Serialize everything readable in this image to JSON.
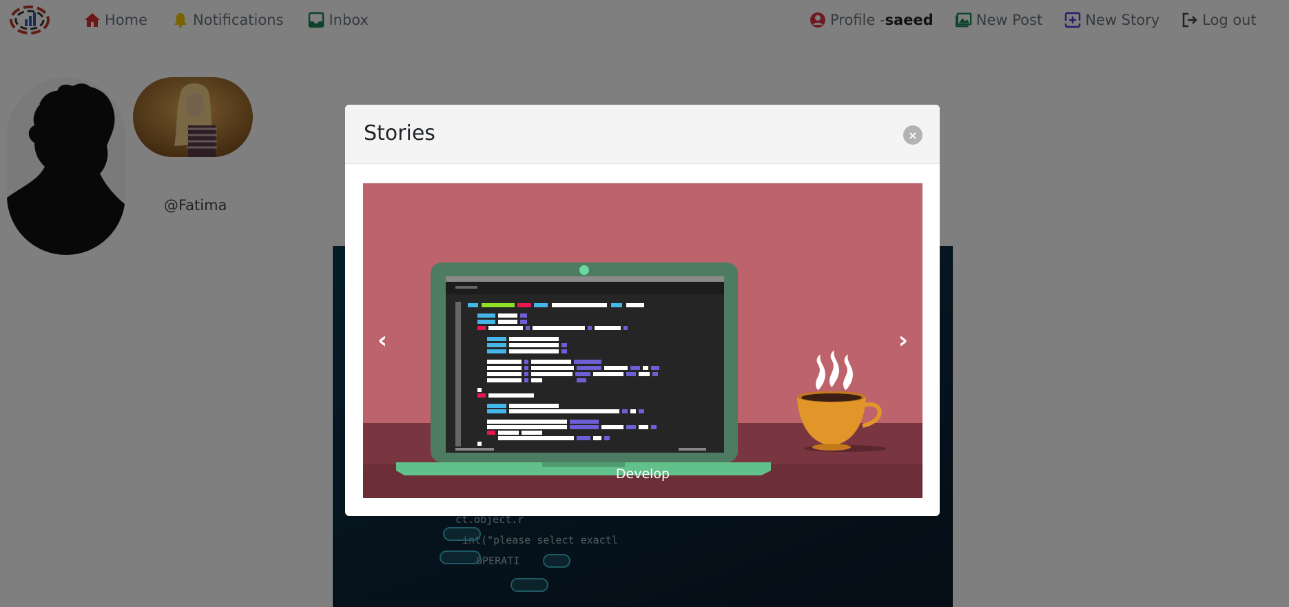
{
  "nav": {
    "home": "Home",
    "notifications": "Notifications",
    "inbox": "Inbox",
    "profile_prefix": "Profile -",
    "profile_user": "saeed",
    "new_post": "New Post",
    "new_story": "New Story",
    "logout": "Log out"
  },
  "stories_row": {
    "username": "@Fatima"
  },
  "post": {
    "code_lines": [
      "ct.object.r",
      "int(\"please select exactl",
      "OPERATI"
    ]
  },
  "modal": {
    "title": "Stories",
    "close_icon": "×",
    "prev_icon": "‹",
    "next_icon": "›",
    "slide_caption": "Develop"
  },
  "colors": {
    "home_icon": "#d9302c",
    "bell_icon": "#f4c400",
    "inbox_icon": "#198754",
    "profile_icon": "#dc3545",
    "new_post_icon": "#198754",
    "new_story_icon": "#5a35d6",
    "logout_icon": "#444444",
    "slide_bg": "#bd636b"
  }
}
